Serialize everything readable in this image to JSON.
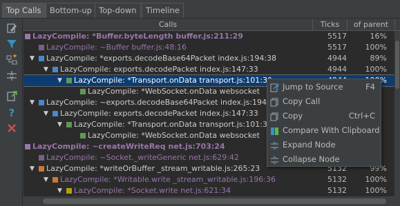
{
  "tabs": [
    "Top Calls",
    "Bottom-up",
    "Top-down",
    "Timeline"
  ],
  "active_tab": "Top Calls",
  "columns": {
    "calls": "Calls",
    "ticks": "Ticks",
    "of_parent": "of parent"
  },
  "colors": {
    "purple": "#9876aa",
    "blue": "#4a88c7",
    "green": "#629755",
    "orange": "#cc7832",
    "yellow": "#b8a000",
    "selection": "#0d3c70"
  },
  "rows": [
    {
      "text": "LazyCompile: *Buffer.byteLength buffer.js:211:29",
      "ticks": "5517",
      "pct": "16%",
      "bold": true
    },
    {
      "text": "LazyCompile: ~Buffer buffer.js:48:16",
      "ticks": "5517",
      "pct": "100%"
    },
    {
      "text": "LazyCompile: *exports.decodeBase64Packet index.js:194:38",
      "ticks": "4944",
      "pct": "89%"
    },
    {
      "text": "LazyCompile: exports.decodePacket index.js:147:33",
      "ticks": "4944",
      "pct": "100%"
    },
    {
      "text": "LazyCompile: *Transport.onData transport.js:101:30",
      "ticks": "4944",
      "pct": "100%",
      "selected": true
    },
    {
      "text": "LazyCompile: *WebSocket.onData websocket",
      "ticks": "",
      "pct": ""
    },
    {
      "text": "LazyCompile: ~exports.decodeBase64Packet index.js:194:38",
      "ticks": "",
      "pct": ""
    },
    {
      "text": "LazyCompile: exports.decodePacket index.js:147:33",
      "ticks": "",
      "pct": ""
    },
    {
      "text": "LazyCompile: *Transport.onData transport.js:101:3",
      "ticks": "",
      "pct": ""
    },
    {
      "text": "LazyCompile: *WebSocket.onData websocket",
      "ticks": "",
      "pct": ""
    },
    {
      "text": "LazyCompile: ~createWriteReq net.js:703:24",
      "ticks": "",
      "pct": "",
      "bold": true
    },
    {
      "text": "LazyCompile: ~Socket._writeGeneric net.js:629:42",
      "ticks": "",
      "pct": ""
    },
    {
      "text": "LazyCompile: *writeOrBuffer _stream_writable.js:265:23",
      "ticks": "5132",
      "pct": "99%"
    },
    {
      "text": "LazyCompile: *Writable.write _stream_writable.js:196:36",
      "ticks": "5132",
      "pct": "100%"
    },
    {
      "text": "LazyCompile: *Socket.write net.js:621:34",
      "ticks": "5132",
      "pct": "100%"
    }
  ],
  "context_menu": [
    {
      "label": "Jump to Source",
      "shortcut": "F4"
    },
    {
      "label": "Copy Call",
      "shortcut": ""
    },
    {
      "label": "Copy",
      "shortcut": "Ctrl+C"
    },
    {
      "label": "Compare With Clipboard",
      "shortcut": ""
    },
    {
      "label": "Expand Node",
      "shortcut": ""
    },
    {
      "label": "Collapse Node",
      "shortcut": ""
    }
  ]
}
